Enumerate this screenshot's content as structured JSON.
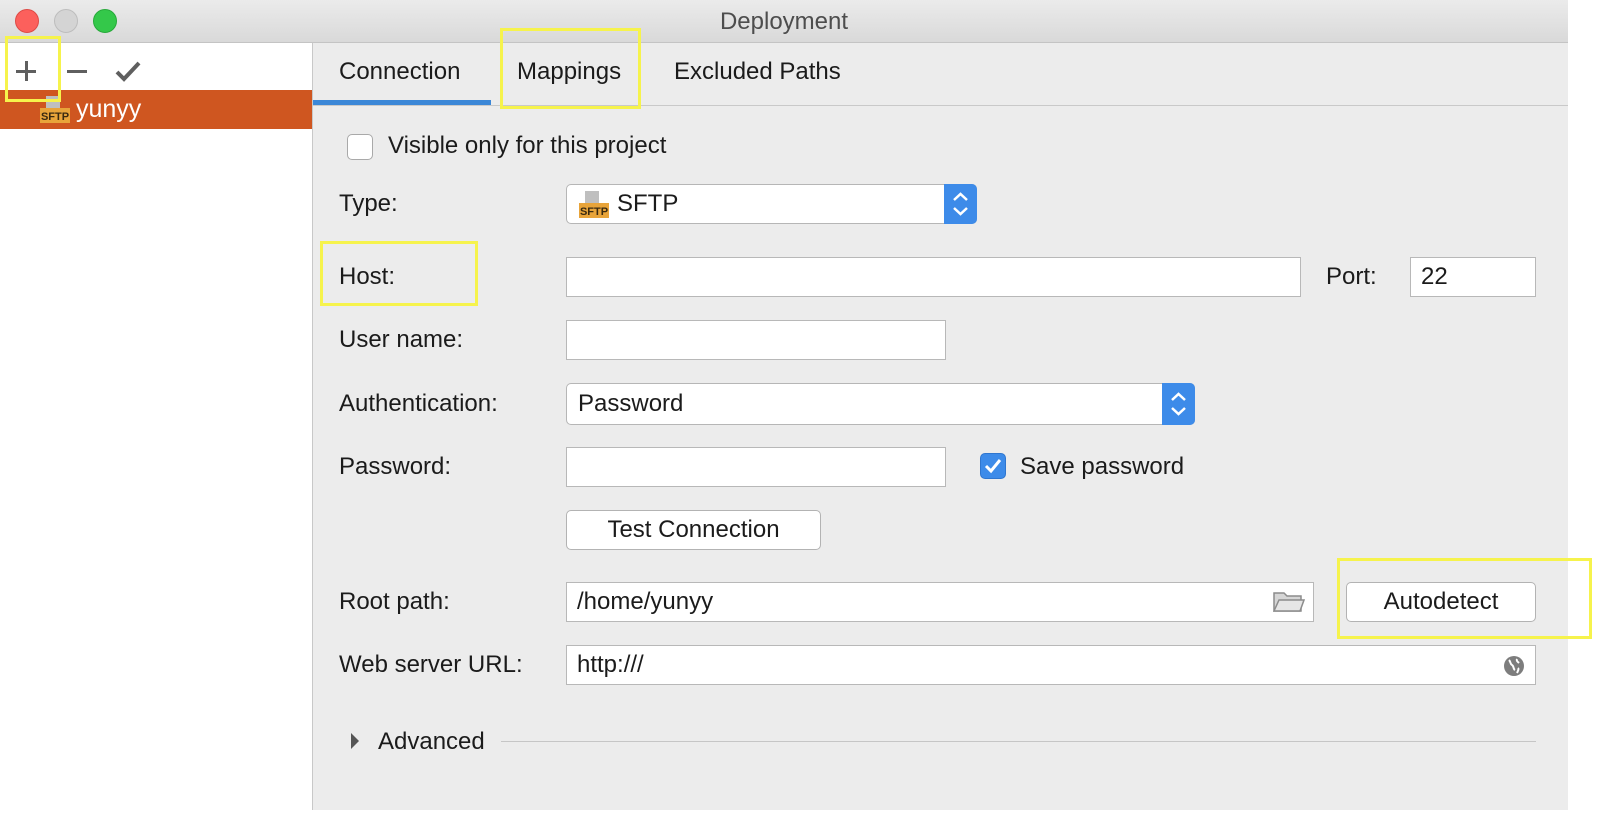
{
  "window": {
    "title": "Deployment"
  },
  "sidebar": {
    "server_name": "yunyy",
    "server_icon_label": "SFTP"
  },
  "tabs": [
    {
      "label": "Connection",
      "active": true
    },
    {
      "label": "Mappings",
      "active": false
    },
    {
      "label": "Excluded Paths",
      "active": false
    }
  ],
  "form": {
    "visible_only_label": "Visible only for this project",
    "visible_only_checked": false,
    "type_label": "Type:",
    "type_value": "SFTP",
    "type_icon_label": "SFTP",
    "host_label": "Host:",
    "host_value": "",
    "port_label": "Port:",
    "port_value": "22",
    "username_label": "User name:",
    "username_value": "",
    "auth_label": "Authentication:",
    "auth_value": "Password",
    "password_label": "Password:",
    "password_value": "",
    "save_password_label": "Save password",
    "save_password_checked": true,
    "test_connection_label": "Test Connection",
    "root_path_label": "Root path:",
    "root_path_value": "/home/yunyy",
    "autodetect_label": "Autodetect",
    "web_url_label": "Web server URL:",
    "web_url_value": "http:///",
    "advanced_label": "Advanced"
  },
  "colors": {
    "selection": "#cf5620",
    "accent": "#3d8be9",
    "highlight": "#f6f34c"
  },
  "icons": [
    "add-icon",
    "remove-icon",
    "check-icon",
    "sftp-icon",
    "folder-icon",
    "globe-icon",
    "chevron-right-icon",
    "select-arrows-icon"
  ]
}
